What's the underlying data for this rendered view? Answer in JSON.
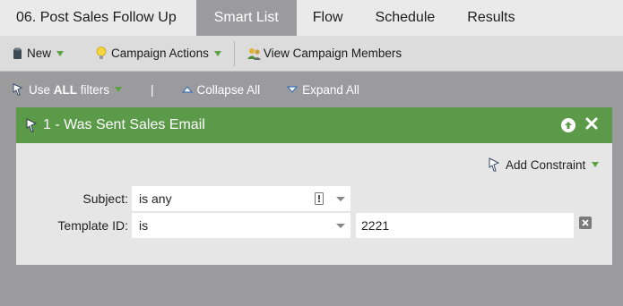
{
  "tabs": [
    {
      "label": "06. Post Sales Follow Up",
      "active": false
    },
    {
      "label": "Smart List",
      "active": true
    },
    {
      "label": "Flow",
      "active": false
    },
    {
      "label": "Schedule",
      "active": false
    },
    {
      "label": "Results",
      "active": false
    }
  ],
  "toolbar": {
    "new_label": "New",
    "campaign_actions_label": "Campaign Actions",
    "view_members_label": "View Campaign Members"
  },
  "filterbar": {
    "use_prefix": "Use ",
    "use_all": "ALL",
    "use_suffix": " filters",
    "separator": "|",
    "collapse_label": "Collapse All",
    "expand_label": "Expand All"
  },
  "filter": {
    "title": "1 - Was Sent Sales Email",
    "add_constraint_label": "Add Constraint",
    "rows": [
      {
        "label": "Subject:",
        "operator": "is any",
        "value": ""
      },
      {
        "label": "Template ID:",
        "operator": "is",
        "value": "2221"
      }
    ]
  },
  "colors": {
    "header_green": "#5b9a48",
    "caret_green": "#5aa245",
    "background_gray": "#9b9b9e"
  }
}
